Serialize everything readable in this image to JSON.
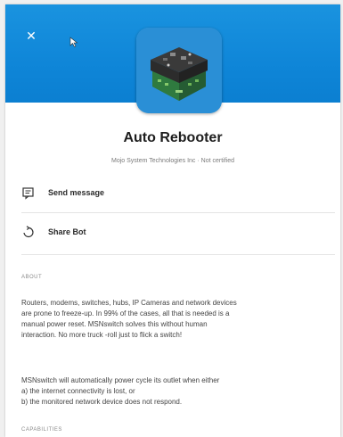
{
  "app": {
    "name": "Auto Rebooter",
    "publisher_line": "Mojo System Technologies Inc · Not certified"
  },
  "actions": [
    {
      "label": "Send message",
      "icon": "message-icon"
    },
    {
      "label": "Share Bot",
      "icon": "share-icon"
    }
  ],
  "about": {
    "header": "ABOUT",
    "paragraph_1_lines": [
      "Routers, modems, switches, hubs, IP Cameras and network devices",
      "are prone to freeze-up. In 99% of the cases, all that is needed is a",
      "manual power reset. MSNswitch solves this without human",
      "interaction. No more truck -roll just to flick a switch!"
    ],
    "paragraph_2_lines": [
      "MSNswitch will automatically power cycle its outlet when either",
      "a) the internet connectivity is lost, or",
      "b) the monitored network device does not respond."
    ]
  },
  "capabilities": {
    "header": "CAPABILITIES"
  },
  "colors": {
    "banner": "#0f86d8",
    "title": "#1e1e1e"
  }
}
